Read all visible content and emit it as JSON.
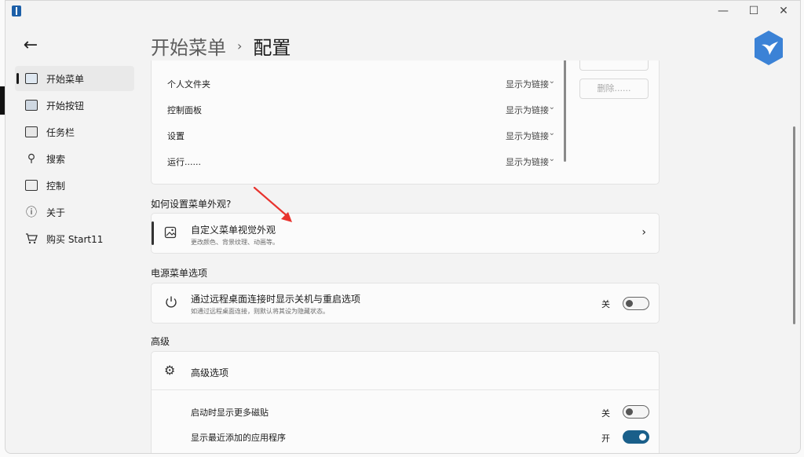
{
  "breadcrumb": {
    "parent": "开始菜单",
    "current": "配置"
  },
  "sidebar": {
    "items": [
      {
        "label": "开始菜单",
        "icon": "start-menu-icon",
        "active": true
      },
      {
        "label": "开始按钮",
        "icon": "start-button-icon"
      },
      {
        "label": "任务栏",
        "icon": "taskbar-icon"
      },
      {
        "label": "搜索",
        "icon": "search-icon"
      },
      {
        "label": "控制",
        "icon": "control-icon"
      },
      {
        "label": "关于",
        "icon": "info-icon"
      },
      {
        "label": "购买 Start11",
        "icon": "cart-icon"
      }
    ]
  },
  "folders": {
    "rows": [
      {
        "name": "个人文件夹",
        "value": "显示为链接"
      },
      {
        "name": "控制面板",
        "value": "显示为链接"
      },
      {
        "name": "设置",
        "value": "显示为链接"
      },
      {
        "name": "运行......",
        "value": "显示为链接"
      }
    ],
    "delete_label": "删除......"
  },
  "appearance": {
    "section_title": "如何设置菜单外观?",
    "item_title": "自定义菜单视觉外观",
    "item_subtitle": "更改颜色、背景纹理、动画等。"
  },
  "power": {
    "section_title": "电源菜单选项",
    "item_title": "通过远程桌面连接时显示关机与重启选项",
    "item_subtitle": "如通过远程桌面连接，则默认将其设为隐藏状态。",
    "toggle_label": "关",
    "toggle_on": false
  },
  "advanced": {
    "section_title": "高级",
    "header": "高级选项",
    "rows": [
      {
        "label": "启动时显示更多磁贴",
        "toggle_label": "关",
        "toggle_on": false
      },
      {
        "label": "显示最近添加的应用程序",
        "toggle_label": "开",
        "toggle_on": true
      }
    ]
  },
  "colors": {
    "accent": "#1a5f8a",
    "annotation_arrow": "#e8332e",
    "logo": "#3b82d6"
  }
}
